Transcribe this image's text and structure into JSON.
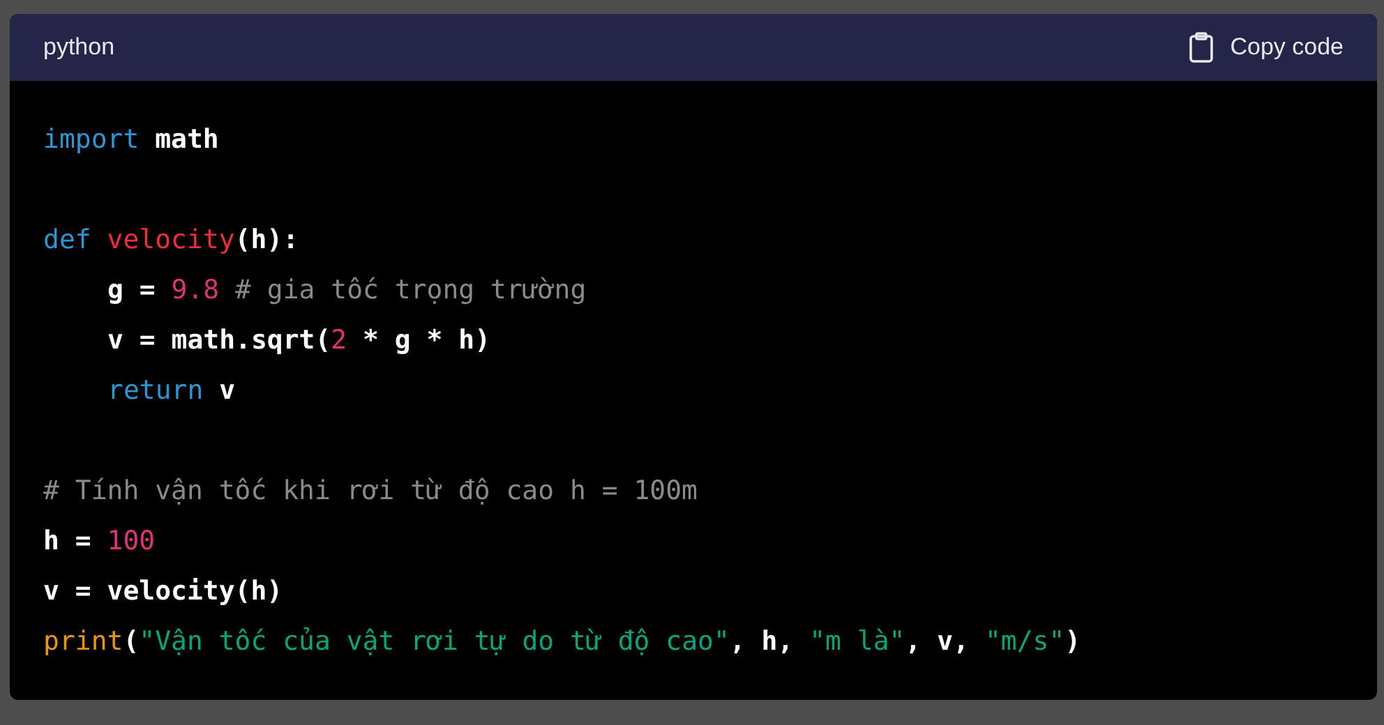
{
  "header": {
    "language": "python",
    "copy_button": "Copy code"
  },
  "blocks": [
    [
      {
        "tokens": [
          {
            "kind": "keyword",
            "text": "import"
          },
          {
            "kind": "name",
            "text": " math"
          }
        ]
      }
    ],
    [
      {
        "tokens": [
          {
            "kind": "keyword",
            "text": "def "
          },
          {
            "kind": "function",
            "text": "velocity"
          },
          {
            "kind": "name",
            "text": "(h):"
          }
        ],
        "children": [
          {
            "tokens": [
              {
                "kind": "name",
                "text": "g = "
              },
              {
                "kind": "number",
                "text": "9.8"
              },
              {
                "kind": "comment",
                "text": " # gia tốc trọng trường"
              }
            ]
          },
          {
            "tokens": [
              {
                "kind": "name",
                "text": "v = math.sqrt("
              },
              {
                "kind": "number",
                "text": "2"
              },
              {
                "kind": "name",
                "text": " * g * h)"
              }
            ]
          },
          {
            "tokens": [
              {
                "kind": "keyword",
                "text": "return"
              },
              {
                "kind": "name",
                "text": " v"
              }
            ]
          }
        ]
      }
    ],
    [
      {
        "tokens": [
          {
            "kind": "comment",
            "text": "# Tính vận tốc khi rơi từ độ cao h = 100m"
          }
        ]
      },
      {
        "tokens": [
          {
            "kind": "name",
            "text": "h = "
          },
          {
            "kind": "number",
            "text": "100"
          }
        ]
      },
      {
        "tokens": [
          {
            "kind": "name",
            "text": "v = velocity(h)"
          }
        ]
      },
      {
        "tokens": [
          {
            "kind": "builtin",
            "text": "print"
          },
          {
            "kind": "name",
            "text": "("
          },
          {
            "kind": "string",
            "text": "\"Vận tốc của vật rơi tự do từ độ cao\""
          },
          {
            "kind": "name",
            "text": ", h, "
          },
          {
            "kind": "string",
            "text": "\"m là\""
          },
          {
            "kind": "name",
            "text": ", v, "
          },
          {
            "kind": "string",
            "text": "\"m/s\""
          },
          {
            "kind": "name",
            "text": ")"
          }
        ]
      }
    ]
  ]
}
